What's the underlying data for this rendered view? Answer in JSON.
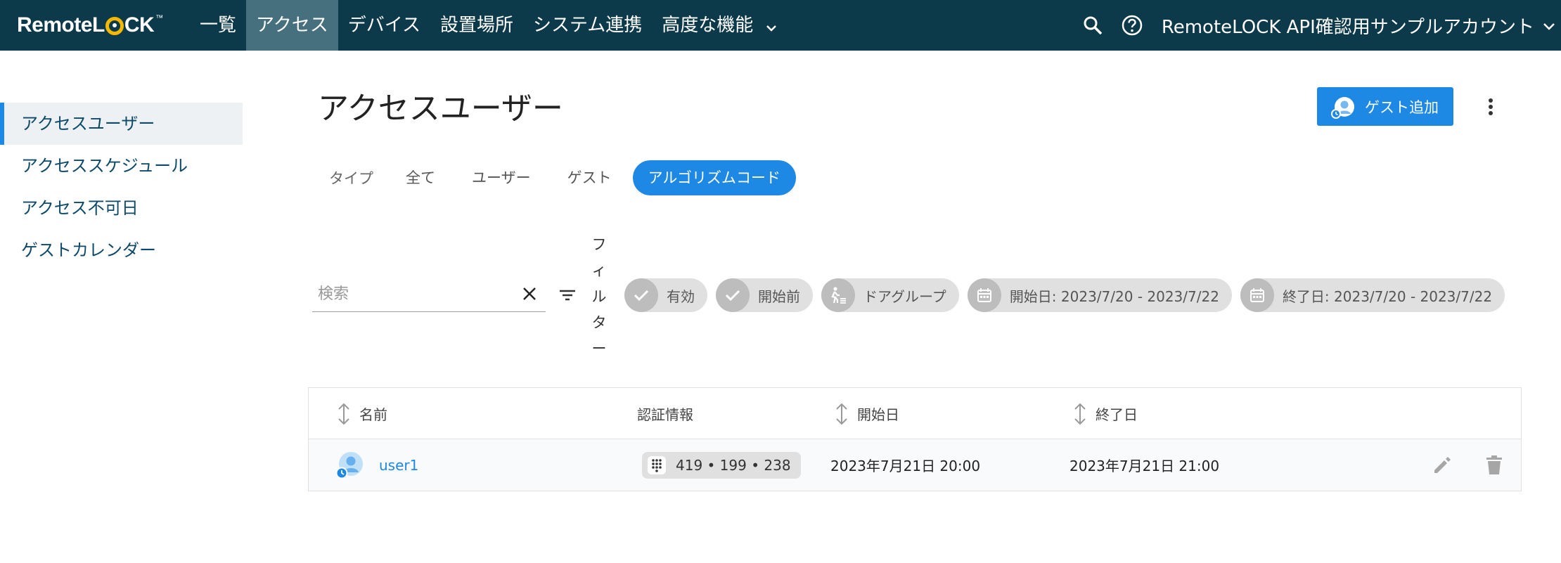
{
  "header": {
    "logo_text": "RemoteLOCK",
    "nav": [
      {
        "label": "一覧"
      },
      {
        "label": "アクセス",
        "active": true
      },
      {
        "label": "デバイス"
      },
      {
        "label": "設置場所"
      },
      {
        "label": "システム連携"
      },
      {
        "label": "高度な機能",
        "has_dropdown": true
      }
    ],
    "account_name": "RemoteLOCK API確認用サンプルアカウント",
    "icons": [
      "search-icon",
      "help-icon",
      "chevron-down-icon"
    ]
  },
  "sidebar": {
    "items": [
      {
        "label": "アクセスユーザー",
        "active": true
      },
      {
        "label": "アクセススケジュール"
      },
      {
        "label": "アクセス不可日"
      },
      {
        "label": "ゲストカレンダー"
      }
    ]
  },
  "main": {
    "title": "アクセスユーザー",
    "add_guest_label": "ゲスト追加",
    "tabs": {
      "type_label": "タイプ",
      "items": [
        {
          "label": "全て"
        },
        {
          "label": "ユーザー"
        },
        {
          "label": "ゲスト"
        },
        {
          "label": "アルゴリズムコード",
          "active": true
        }
      ]
    },
    "search": {
      "placeholder": "検索",
      "value": ""
    },
    "filter_label": "フィルター",
    "filter_chars": [
      "フ",
      "ィ",
      "ル",
      "タ",
      "ー"
    ],
    "chips": [
      {
        "icon": "check-icon",
        "label": "有効"
      },
      {
        "icon": "check-icon",
        "label": "開始前"
      },
      {
        "icon": "door-group-icon",
        "label": "ドアグループ"
      },
      {
        "icon": "calendar-icon",
        "label": "開始日: 2023/7/20 - 2023/7/22"
      },
      {
        "icon": "calendar-icon",
        "label": "終了日: 2023/7/20 - 2023/7/22"
      }
    ],
    "table": {
      "columns": [
        {
          "label": "名前",
          "sortable": true
        },
        {
          "label": "認証情報",
          "sortable": false
        },
        {
          "label": "開始日",
          "sortable": true
        },
        {
          "label": "終了日",
          "sortable": true
        }
      ],
      "rows": [
        {
          "name": "user1",
          "credential": "419 • 199 • 238",
          "start": "2023年7月21日 20:00",
          "end": "2023年7月21日 21:00"
        }
      ]
    }
  },
  "colors": {
    "topbar": "#0d3a4a",
    "nav_active": "#46707e",
    "accent": "#1e88e5",
    "chip_bg": "#e0e0e0"
  }
}
